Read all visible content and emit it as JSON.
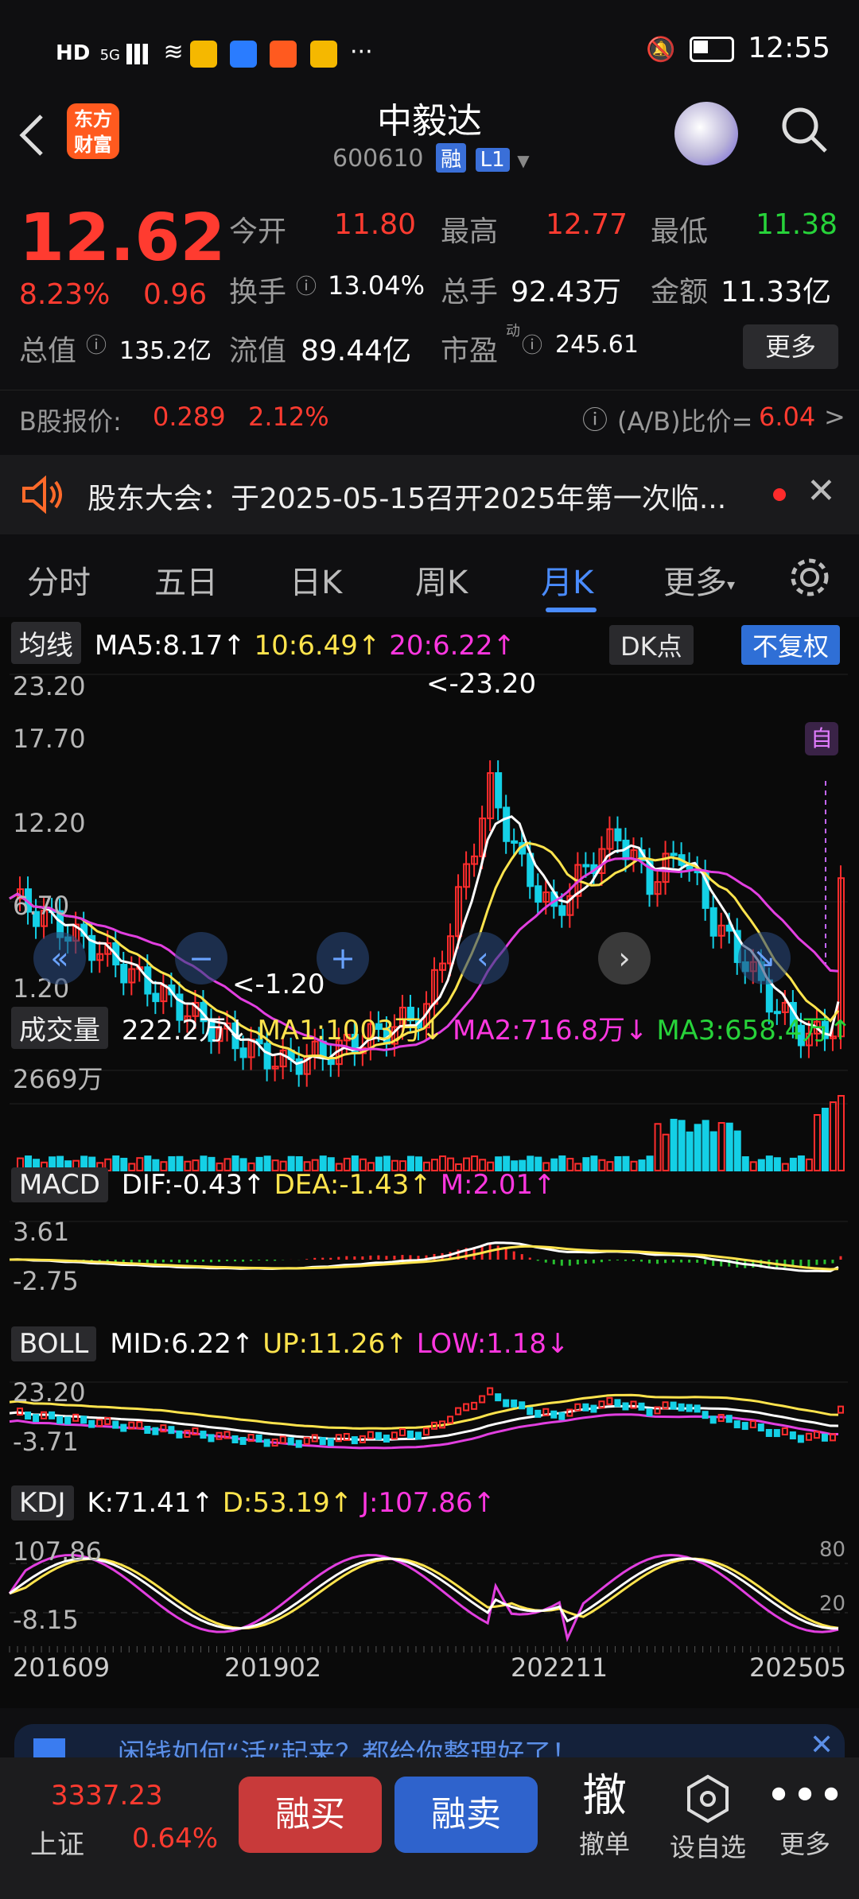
{
  "status": {
    "carrier_left": "HD",
    "network": "5G",
    "time": "12:55",
    "more": "···"
  },
  "header": {
    "back_icon": "chevron-left-icon",
    "logo_line1": "东方",
    "logo_line2": "财富",
    "name": "中毅达",
    "code": "600610",
    "badge_rong": "融",
    "badge_level": "L1"
  },
  "quote": {
    "price": "12.62",
    "change_pct": "8.23%",
    "change": "0.96",
    "open_label": "今开",
    "open": "11.80",
    "high_label": "最高",
    "high": "12.77",
    "low_label": "最低",
    "low": "11.38",
    "turnover_label": "换手",
    "turnover": "13.04%",
    "volume_label": "总手",
    "volume": "92.43万",
    "amount_label": "金额",
    "amount": "11.33亿",
    "mcap_label": "总值",
    "mcap": "135.2亿",
    "float_label": "流值",
    "float": "89.44亿",
    "pe_label": "市盈",
    "pe_sup": "动",
    "pe": "245.61",
    "more": "更多"
  },
  "bshare": {
    "label": "B股报价:",
    "price": "0.289",
    "pct": "2.12%",
    "ratio_label": "(A/B)比价=",
    "ratio": "6.04",
    "arrow": ">"
  },
  "notice": {
    "text": "股东大会：于2025-05-15召开2025年第一次临..."
  },
  "tabs": [
    "分时",
    "五日",
    "日K",
    "周K",
    "月K",
    "更多"
  ],
  "chart": {
    "ma_btn": "均线",
    "ma5": "MA5:8.17",
    "ma10": "10:6.49",
    "ma20": "20:6.22",
    "dk_btn": "DK点",
    "fq_btn": "不复权",
    "y_labels": [
      "23.20",
      "17.70",
      "12.20",
      "6.70",
      "1.20"
    ],
    "max_label": "<-23.20",
    "min_label": "<-1.20",
    "zi": "自",
    "vol_btn": "成交量",
    "vol": "222.2万",
    "vol_ma1": "MA1:1003万",
    "vol_ma2": "MA2:716.8万",
    "vol_ma3": "MA3:658.4万",
    "vol_max": "2669万",
    "macd_btn": "MACD",
    "dif": "DIF:-0.43",
    "dea": "DEA:-1.43",
    "m": "M:2.01",
    "macd_top": "3.61",
    "macd_bot": "-2.75",
    "boll_btn": "BOLL",
    "mid": "MID:6.22",
    "up": "UP:11.26",
    "low": "LOW:1.18",
    "boll_top": "23.20",
    "boll_bot": "-3.71",
    "kdj_btn": "KDJ",
    "k": "K:71.41",
    "d": "D:53.19",
    "j": "J:107.86",
    "kdj_top": "107.86",
    "kdj_bot": "-8.15",
    "kdj_80": "80",
    "kdj_20": "20",
    "dates": [
      "201609",
      "201902",
      "202211",
      "202505"
    ]
  },
  "ad": {
    "text": "闲钱如何“活”起来？都给你整理好了！"
  },
  "bottom": {
    "index_val": "3337.23",
    "index_name": "上证",
    "index_pct": "0.64%",
    "buy": "融买",
    "sell": "融卖",
    "cancel_glyph": "撤",
    "cancel": "撤单",
    "watch": "设自选",
    "more": "更多"
  }
}
